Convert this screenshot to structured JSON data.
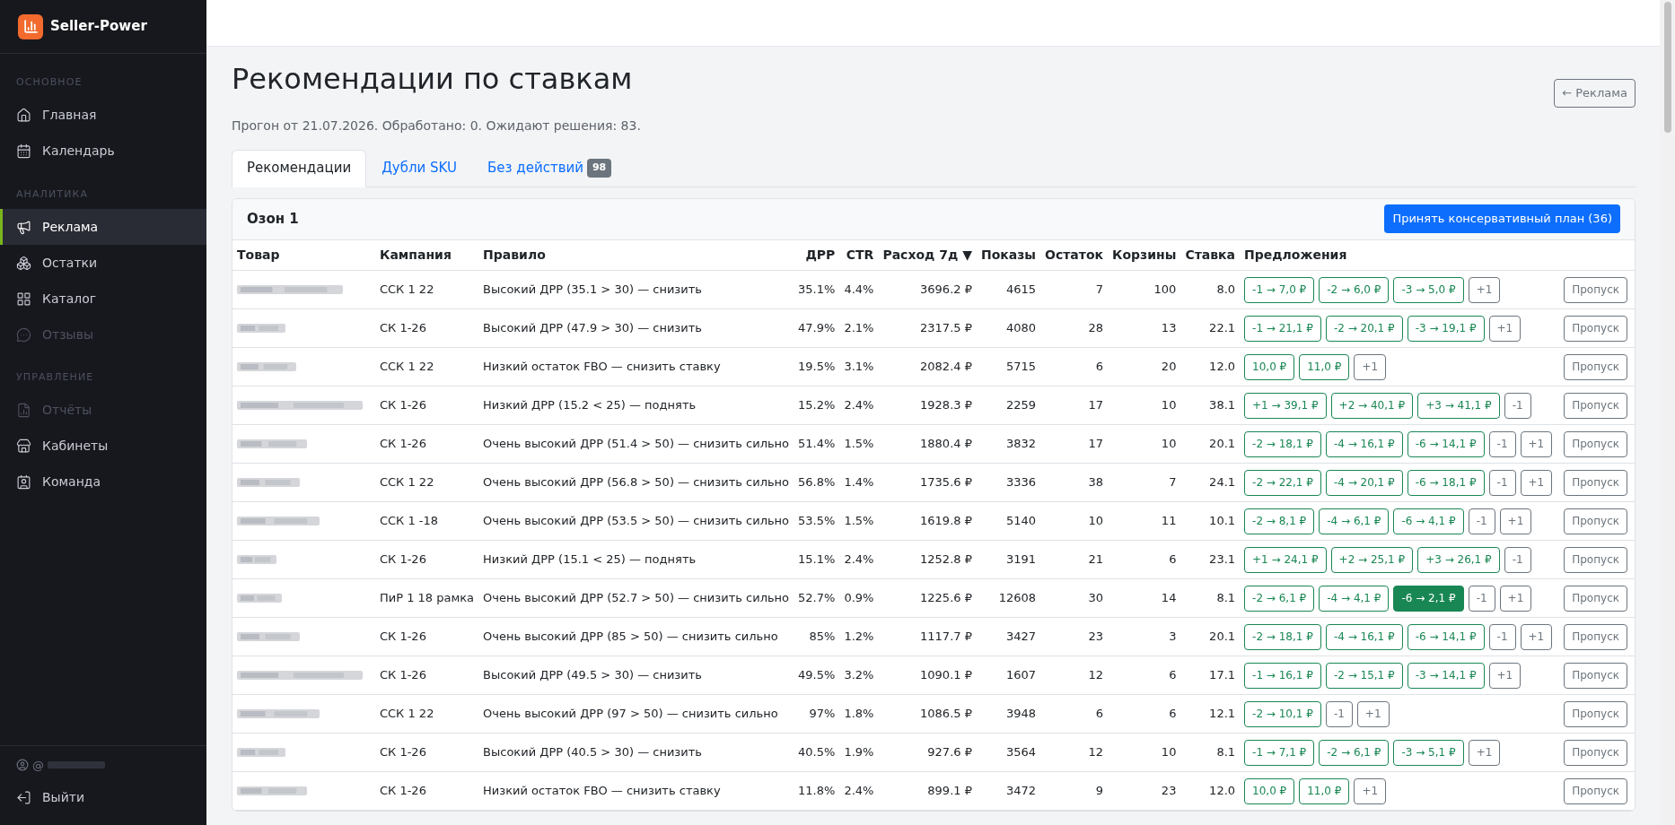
{
  "brand": {
    "name": "Seller-Power"
  },
  "sidebar": {
    "sections": [
      {
        "title": "ОСНОВНОЕ",
        "items": [
          {
            "label": "Главная",
            "selected": false,
            "disabled": false
          },
          {
            "label": "Календарь",
            "selected": false,
            "disabled": false
          }
        ]
      },
      {
        "title": "АНАЛИТИКА",
        "items": [
          {
            "label": "Реклама",
            "selected": true,
            "disabled": false
          },
          {
            "label": "Остатки",
            "selected": false,
            "disabled": false
          },
          {
            "label": "Каталог",
            "selected": false,
            "disabled": false
          },
          {
            "label": "Отзывы",
            "selected": false,
            "disabled": true
          }
        ]
      },
      {
        "title": "УПРАВЛЕНИЕ",
        "items": [
          {
            "label": "Отчёты",
            "selected": false,
            "disabled": true
          },
          {
            "label": "Кабинеты",
            "selected": false,
            "disabled": false
          },
          {
            "label": "Команда",
            "selected": false,
            "disabled": false
          }
        ]
      }
    ],
    "user": {
      "prefix": "@"
    },
    "logout": "Выйти"
  },
  "page": {
    "title": "Рекомендации по ставкам",
    "subtitle": "Прогон от 21.07.2026. Обработано: 0. Ожидают решения: 83.",
    "back_button": "← Реклама"
  },
  "tabs": [
    {
      "label": "Рекомендации",
      "selected": true
    },
    {
      "label": "Дубли SKU",
      "selected": false
    },
    {
      "label": "Без действий",
      "badge": "98",
      "selected": false
    }
  ],
  "card": {
    "title": "Озон 1",
    "accept_button": "Принять консервативный план (36)",
    "columns": [
      "Товар",
      "Кампания",
      "Правило",
      "ДРР",
      "CTR",
      "Расход 7д ▼",
      "Показы",
      "Остаток",
      "Корзины",
      "Ставка",
      "Предложения"
    ],
    "rows": [
      {
        "campaign": "ССК 1 22",
        "rule": "Высокий ДРР (35.1 > 30) — снизить",
        "drr": "35.1%",
        "ctr": "4.4%",
        "spend": "3696.2 ₽",
        "views": "4615",
        "stock": "7",
        "carts": "100",
        "bid": "8.0",
        "skip": "Пропуск",
        "suggestions": [
          {
            "label": "-1 → 7,0 ₽",
            "kind": "step",
            "active": false
          },
          {
            "label": "-2 → 6,0 ₽",
            "kind": "step",
            "active": false
          },
          {
            "label": "-3 → 5,0 ₽",
            "kind": "step",
            "active": false
          },
          {
            "label": "+1",
            "kind": "nudge",
            "active": false
          }
        ]
      },
      {
        "campaign": "СК 1-26",
        "rule": "Высокий ДРР (47.9 > 30) — снизить",
        "drr": "47.9%",
        "ctr": "2.1%",
        "spend": "2317.5 ₽",
        "views": "4080",
        "stock": "28",
        "carts": "13",
        "bid": "22.1",
        "skip": "Пропуск",
        "suggestions": [
          {
            "label": "-1 → 21,1 ₽",
            "kind": "step",
            "active": false
          },
          {
            "label": "-2 → 20,1 ₽",
            "kind": "step",
            "active": false
          },
          {
            "label": "-3 → 19,1 ₽",
            "kind": "step",
            "active": false
          },
          {
            "label": "+1",
            "kind": "nudge",
            "active": false
          }
        ]
      },
      {
        "campaign": "ССК 1 22",
        "rule": "Низкий остаток FBO — снизить ставку",
        "drr": "19.5%",
        "ctr": "3.1%",
        "spend": "2082.4 ₽",
        "views": "5715",
        "stock": "6",
        "carts": "20",
        "bid": "12.0",
        "skip": "Пропуск",
        "suggestions": [
          {
            "label": "10,0 ₽",
            "kind": "step",
            "active": false
          },
          {
            "label": "11,0 ₽",
            "kind": "step",
            "active": false
          },
          {
            "label": "+1",
            "kind": "nudge",
            "active": false
          }
        ]
      },
      {
        "campaign": "СК 1-26",
        "rule": "Низкий ДРР (15.2 < 25) — поднять",
        "drr": "15.2%",
        "ctr": "2.4%",
        "spend": "1928.3 ₽",
        "views": "2259",
        "stock": "17",
        "carts": "10",
        "bid": "38.1",
        "skip": "Пропуск",
        "suggestions": [
          {
            "label": "+1 → 39,1 ₽",
            "kind": "step",
            "active": false
          },
          {
            "label": "+2 → 40,1 ₽",
            "kind": "step",
            "active": false
          },
          {
            "label": "+3 → 41,1 ₽",
            "kind": "step",
            "active": false
          },
          {
            "label": "-1",
            "kind": "nudge",
            "active": false
          }
        ]
      },
      {
        "campaign": "СК 1-26",
        "rule": "Очень высокий ДРР (51.4 > 50) — снизить сильно",
        "drr": "51.4%",
        "ctr": "1.5%",
        "spend": "1880.4 ₽",
        "views": "3832",
        "stock": "17",
        "carts": "10",
        "bid": "20.1",
        "skip": "Пропуск",
        "suggestions": [
          {
            "label": "-2 → 18,1 ₽",
            "kind": "step",
            "active": false
          },
          {
            "label": "-4 → 16,1 ₽",
            "kind": "step",
            "active": false
          },
          {
            "label": "-6 → 14,1 ₽",
            "kind": "step",
            "active": false
          },
          {
            "label": "-1",
            "kind": "nudge",
            "active": false
          },
          {
            "label": "+1",
            "kind": "nudge",
            "active": false
          }
        ]
      },
      {
        "campaign": "ССК 1 22",
        "rule": "Очень высокий ДРР (56.8 > 50) — снизить сильно",
        "drr": "56.8%",
        "ctr": "1.4%",
        "spend": "1735.6 ₽",
        "views": "3336",
        "stock": "38",
        "carts": "7",
        "bid": "24.1",
        "skip": "Пропуск",
        "suggestions": [
          {
            "label": "-2 → 22,1 ₽",
            "kind": "step",
            "active": false
          },
          {
            "label": "-4 → 20,1 ₽",
            "kind": "step",
            "active": false
          },
          {
            "label": "-6 → 18,1 ₽",
            "kind": "step",
            "active": false
          },
          {
            "label": "-1",
            "kind": "nudge",
            "active": false
          },
          {
            "label": "+1",
            "kind": "nudge",
            "active": false
          }
        ]
      },
      {
        "campaign": "ССК 1 -18",
        "rule": "Очень высокий ДРР (53.5 > 50) — снизить сильно",
        "drr": "53.5%",
        "ctr": "1.5%",
        "spend": "1619.8 ₽",
        "views": "5140",
        "stock": "10",
        "carts": "11",
        "bid": "10.1",
        "skip": "Пропуск",
        "suggestions": [
          {
            "label": "-2 → 8,1 ₽",
            "kind": "step",
            "active": false
          },
          {
            "label": "-4 → 6,1 ₽",
            "kind": "step",
            "active": false
          },
          {
            "label": "-6 → 4,1 ₽",
            "kind": "step",
            "active": false
          },
          {
            "label": "-1",
            "kind": "nudge",
            "active": false
          },
          {
            "label": "+1",
            "kind": "nudge",
            "active": false
          }
        ]
      },
      {
        "campaign": "СК 1-26",
        "rule": "Низкий ДРР (15.1 < 25) — поднять",
        "drr": "15.1%",
        "ctr": "2.4%",
        "spend": "1252.8 ₽",
        "views": "3191",
        "stock": "21",
        "carts": "6",
        "bid": "23.1",
        "skip": "Пропуск",
        "suggestions": [
          {
            "label": "+1 → 24,1 ₽",
            "kind": "step",
            "active": false
          },
          {
            "label": "+2 → 25,1 ₽",
            "kind": "step",
            "active": false
          },
          {
            "label": "+3 → 26,1 ₽",
            "kind": "step",
            "active": false
          },
          {
            "label": "-1",
            "kind": "nudge",
            "active": false
          }
        ]
      },
      {
        "campaign": "ПиР 1 18 рамка",
        "rule": "Очень высокий ДРР (52.7 > 50) — снизить сильно",
        "drr": "52.7%",
        "ctr": "0.9%",
        "spend": "1225.6 ₽",
        "views": "12608",
        "stock": "30",
        "carts": "14",
        "bid": "8.1",
        "skip": "Пропуск",
        "suggestions": [
          {
            "label": "-2 → 6,1 ₽",
            "kind": "step",
            "active": false
          },
          {
            "label": "-4 → 4,1 ₽",
            "kind": "step",
            "active": false
          },
          {
            "label": "-6 → 2,1 ₽",
            "kind": "step",
            "active": true
          },
          {
            "label": "-1",
            "kind": "nudge",
            "active": false
          },
          {
            "label": "+1",
            "kind": "nudge",
            "active": false
          }
        ]
      },
      {
        "campaign": "СК 1-26",
        "rule": "Очень высокий ДРР (85 > 50) — снизить сильно",
        "drr": "85%",
        "ctr": "1.2%",
        "spend": "1117.7 ₽",
        "views": "3427",
        "stock": "23",
        "carts": "3",
        "bid": "20.1",
        "skip": "Пропуск",
        "suggestions": [
          {
            "label": "-2 → 18,1 ₽",
            "kind": "step",
            "active": false
          },
          {
            "label": "-4 → 16,1 ₽",
            "kind": "step",
            "active": false
          },
          {
            "label": "-6 → 14,1 ₽",
            "kind": "step",
            "active": false
          },
          {
            "label": "-1",
            "kind": "nudge",
            "active": false
          },
          {
            "label": "+1",
            "kind": "nudge",
            "active": false
          }
        ]
      },
      {
        "campaign": "СК 1-26",
        "rule": "Высокий ДРР (49.5 > 30) — снизить",
        "drr": "49.5%",
        "ctr": "3.2%",
        "spend": "1090.1 ₽",
        "views": "1607",
        "stock": "12",
        "carts": "6",
        "bid": "17.1",
        "skip": "Пропуск",
        "suggestions": [
          {
            "label": "-1 → 16,1 ₽",
            "kind": "step",
            "active": false
          },
          {
            "label": "-2 → 15,1 ₽",
            "kind": "step",
            "active": false
          },
          {
            "label": "-3 → 14,1 ₽",
            "kind": "step",
            "active": false
          },
          {
            "label": "+1",
            "kind": "nudge",
            "active": false
          }
        ]
      },
      {
        "campaign": "ССК 1 22",
        "rule": "Очень высокий ДРР (97 > 50) — снизить сильно",
        "drr": "97%",
        "ctr": "1.8%",
        "spend": "1086.5 ₽",
        "views": "3948",
        "stock": "6",
        "carts": "6",
        "bid": "12.1",
        "skip": "Пропуск",
        "suggestions": [
          {
            "label": "-2 → 10,1 ₽",
            "kind": "step",
            "active": false
          },
          {
            "label": "-1",
            "kind": "nudge",
            "active": false
          },
          {
            "label": "+1",
            "kind": "nudge",
            "active": false
          }
        ]
      },
      {
        "campaign": "СК 1-26",
        "rule": "Высокий ДРР (40.5 > 30) — снизить",
        "drr": "40.5%",
        "ctr": "1.9%",
        "spend": "927.6 ₽",
        "views": "3564",
        "stock": "12",
        "carts": "10",
        "bid": "8.1",
        "skip": "Пропуск",
        "suggestions": [
          {
            "label": "-1 → 7,1 ₽",
            "kind": "step",
            "active": false
          },
          {
            "label": "-2 → 6,1 ₽",
            "kind": "step",
            "active": false
          },
          {
            "label": "-3 → 5,1 ₽",
            "kind": "step",
            "active": false
          },
          {
            "label": "+1",
            "kind": "nudge",
            "active": false
          }
        ]
      },
      {
        "campaign": "СК 1-26",
        "rule": "Низкий остаток FBO — снизить ставку",
        "drr": "11.8%",
        "ctr": "2.4%",
        "spend": "899.1 ₽",
        "views": "3472",
        "stock": "9",
        "carts": "23",
        "bid": "12.0",
        "skip": "Пропуск",
        "suggestions": [
          {
            "label": "10,0 ₽",
            "kind": "step",
            "active": false
          },
          {
            "label": "11,0 ₽",
            "kind": "step",
            "active": false
          },
          {
            "label": "+1",
            "kind": "nudge",
            "active": false
          }
        ]
      }
    ]
  }
}
